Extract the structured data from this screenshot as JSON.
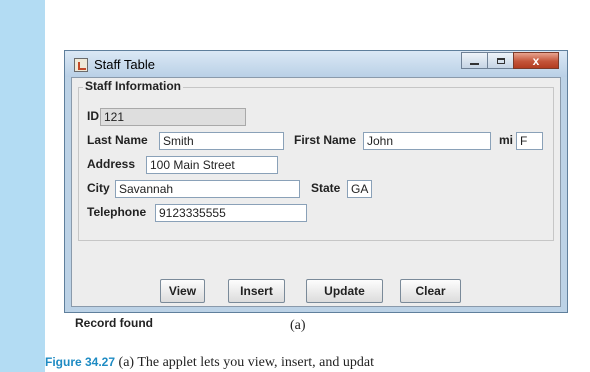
{
  "window": {
    "title": "Staff Table",
    "icons": {
      "app": "java-app-icon",
      "minimize": "minimize-icon",
      "maximize": "maximize-icon",
      "close": "close-icon"
    },
    "close_glyph": "x"
  },
  "form": {
    "group_title": "Staff Information",
    "id": {
      "label": "ID",
      "value": "121"
    },
    "last_name": {
      "label": "Last Name",
      "value": "Smith"
    },
    "first_name": {
      "label": "First Name",
      "value": "John"
    },
    "mi": {
      "label": "mi",
      "value": "F"
    },
    "address": {
      "label": "Address",
      "value": "100 Main Street"
    },
    "city": {
      "label": "City",
      "value": "Savannah"
    },
    "state": {
      "label": "State",
      "value": "GA"
    },
    "telephone": {
      "label": "Telephone",
      "value": "9123335555"
    }
  },
  "buttons": {
    "view": "View",
    "insert": "Insert",
    "update": "Update",
    "clear": "Clear"
  },
  "status": "Record found",
  "caption": "(a)",
  "figure": {
    "label": "Figure 34.27",
    "text": "(a) The applet lets you view, insert, and updat"
  }
}
